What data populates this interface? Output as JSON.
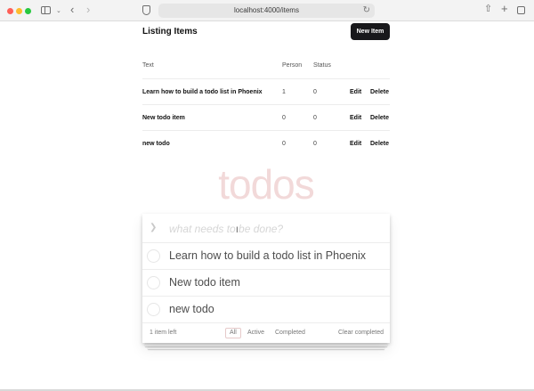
{
  "browser": {
    "url": "localhost:4000/items"
  },
  "listing": {
    "title": "Listing Items",
    "new_item_label": "New Item",
    "columns": {
      "text": "Text",
      "person": "Person",
      "status": "Status"
    },
    "rows": [
      {
        "text": "Learn how to build a todo list in Phoenix",
        "person": "1",
        "status": "0",
        "edit": "Edit",
        "delete": "Delete"
      },
      {
        "text": "New todo item",
        "person": "0",
        "status": "0",
        "edit": "Edit",
        "delete": "Delete"
      },
      {
        "text": "new todo",
        "person": "0",
        "status": "0",
        "edit": "Edit",
        "delete": "Delete"
      }
    ]
  },
  "todo": {
    "title": "todos",
    "placeholder": "what needs to be done?",
    "items": [
      {
        "label": "Learn how to build a todo list in Phoenix"
      },
      {
        "label": "New todo item"
      },
      {
        "label": "new todo"
      }
    ],
    "footer": {
      "count": "1 item left",
      "filters": [
        "All",
        "Active",
        "Completed"
      ],
      "clear": "Clear completed"
    }
  },
  "colors": {
    "accent_button": "#18181b",
    "todos_title": "#f2d9d9"
  }
}
